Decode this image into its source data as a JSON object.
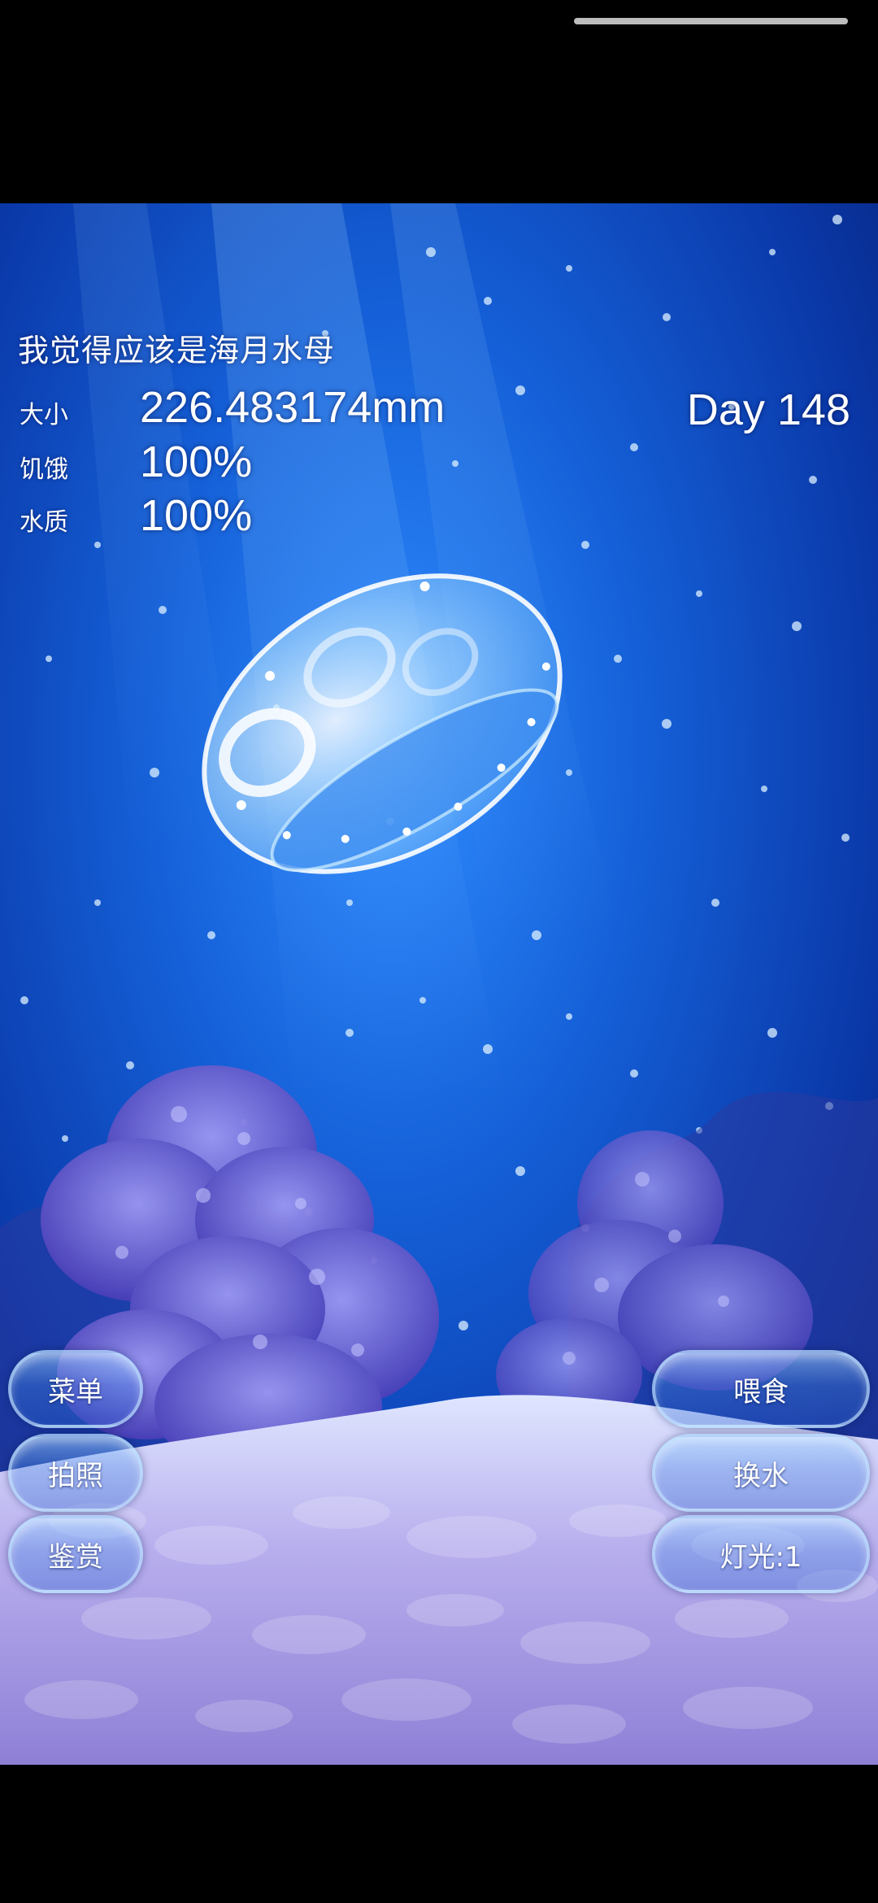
{
  "hud": {
    "guess_text": "我觉得应该是海月水母",
    "stats": [
      {
        "label": "大小",
        "value": "226.483174mm"
      },
      {
        "label": "饥饿",
        "value": "100%"
      },
      {
        "label": "水质",
        "value": "100%"
      }
    ],
    "day": "Day 148"
  },
  "buttons": {
    "left": [
      {
        "label": "菜单"
      },
      {
        "label": "拍照"
      },
      {
        "label": "鉴赏"
      }
    ],
    "right": [
      {
        "label": "喂食"
      },
      {
        "label": "换水"
      },
      {
        "label": "灯光:1"
      }
    ]
  },
  "colors": {
    "water_top": "#0a3f9e",
    "water_mid": "#0f5fd4",
    "water_deep": "#06207a",
    "coral": "#7d7ae0",
    "sand": "#b7a9e8"
  }
}
